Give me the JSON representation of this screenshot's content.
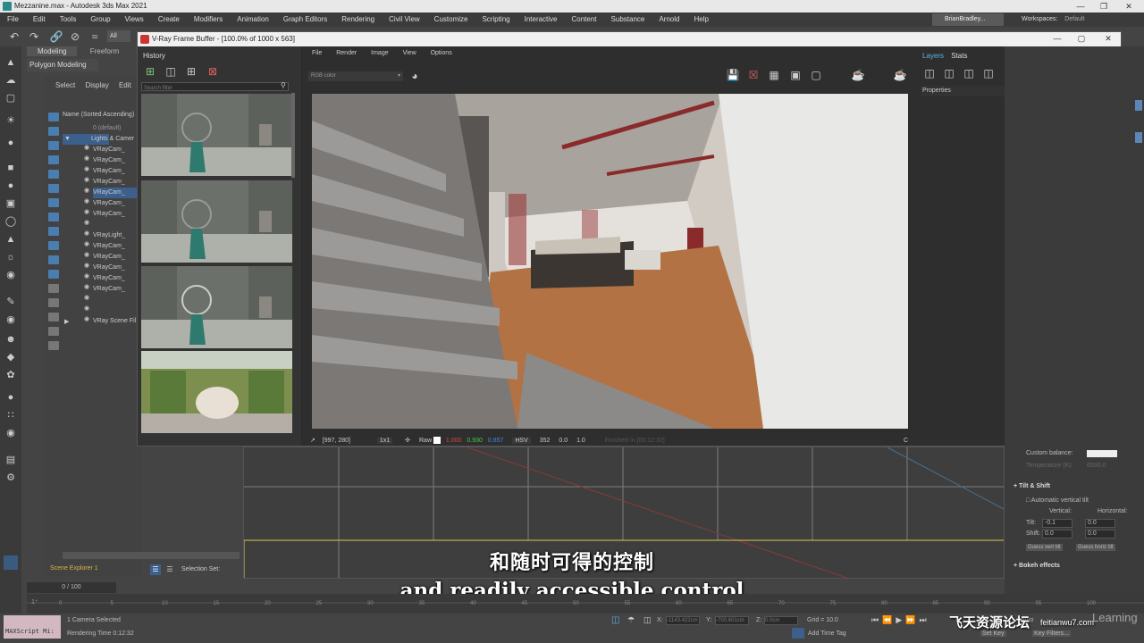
{
  "window": {
    "title": "Mezzanine.max - Autodesk 3ds Max 2021"
  },
  "menu": [
    "File",
    "Edit",
    "Tools",
    "Group",
    "Views",
    "Create",
    "Modifiers",
    "Animation",
    "Graph Editors",
    "Rendering",
    "Civil View",
    "Customize",
    "Scripting",
    "Interactive",
    "Content",
    "Substance",
    "Arnold",
    "Help"
  ],
  "user": "BrianBradley...",
  "workspaces": {
    "label": "Workspaces:",
    "value": "Default"
  },
  "toolbar": {
    "selection_filter": "All"
  },
  "ribbon": {
    "tabs": [
      "Modeling",
      "Freeform"
    ],
    "panel": "Polygon Modeling"
  },
  "scene_explorer": {
    "menu": [
      "Select",
      "Display",
      "Edit"
    ],
    "header": "Name (Sorted Ascending)",
    "rows": [
      "0 (default)",
      "Lights & Camer",
      "VRayCam_",
      "VRayCam_",
      "VRayCam_",
      "VRayCam_",
      "VRayCam_",
      "VRayCam_",
      "VRayCam_",
      "VRayLight_",
      "VRayCam_",
      "VRayCam_",
      "VRayCam_",
      "VRayCam_",
      "VRayCam_",
      "VRay Scene Fil"
    ],
    "footer": "Scene Explorer 1",
    "selection_set": "Selection Set:"
  },
  "vfb": {
    "title": "V-Ray Frame Buffer - [100.0% of 1000 x 563]",
    "history_label": "History",
    "search_placeholder": "Search filter",
    "menu": [
      "File",
      "Render",
      "Image",
      "View",
      "Options"
    ],
    "channel": "RGB color",
    "layers_tab": "Layers",
    "stats_tab": "Stats",
    "properties": "Properties",
    "status": {
      "coords": "[997, 280]",
      "zoom": "1x1",
      "raw": "Raw",
      "r": "1.000",
      "g": "0.930",
      "b": "0.857",
      "mode": "HSV",
      "h": "352",
      "s": "0.0",
      "v": "1.0",
      "extra": "Finished in [00:12:32]",
      "c": "C"
    }
  },
  "right_panel": {
    "custom_balance": "Custom balance:",
    "temperature": "Temperature (K):",
    "temperature_value": "6500.0",
    "tilt_shift": "Tilt & Shift",
    "auto_vertical": "Automatic vertical tilt",
    "vertical": "Vertical:",
    "horizontal": "Horizontal:",
    "tilt": "Tilt:",
    "shift": "Shift:",
    "tilt_v": "-0.1",
    "tilt_h": "0.0",
    "shift_v": "0.0",
    "shift_h": "0.0",
    "guess_vert": "Guess vert tilt",
    "guess_horiz": "Guess horiz tilt",
    "bokeh": "Bokeh effects"
  },
  "subtitles": {
    "cn": "和随时可得的控制",
    "en": "and readily accessible control"
  },
  "timeline": {
    "frame": "0 / 100",
    "ticks": [
      "0",
      "5",
      "10",
      "15",
      "20",
      "25",
      "30",
      "35",
      "40",
      "45",
      "50",
      "55",
      "60",
      "65",
      "70",
      "75",
      "80",
      "85",
      "90",
      "95",
      "100"
    ]
  },
  "status": {
    "maxscript": "MAXScript Mi:",
    "selected": "1 Camera Selected",
    "render_time": "Rendering Time  0:12:32",
    "x": "X:",
    "y": "Y:",
    "z": "Z:",
    "x_val": "-1143.422cm",
    "y_val": "-700.601cm",
    "z_val": "0.0cm",
    "grid": "Grid = 10.0",
    "add_time_tag": "Add Time Tag",
    "set_key": "Set Key",
    "key_filters": "Key Filters...",
    "auto": "Auto"
  },
  "watermark": {
    "site": "飞天资源论坛",
    "url": "feitianwu7.com",
    "brand": "Learning"
  }
}
